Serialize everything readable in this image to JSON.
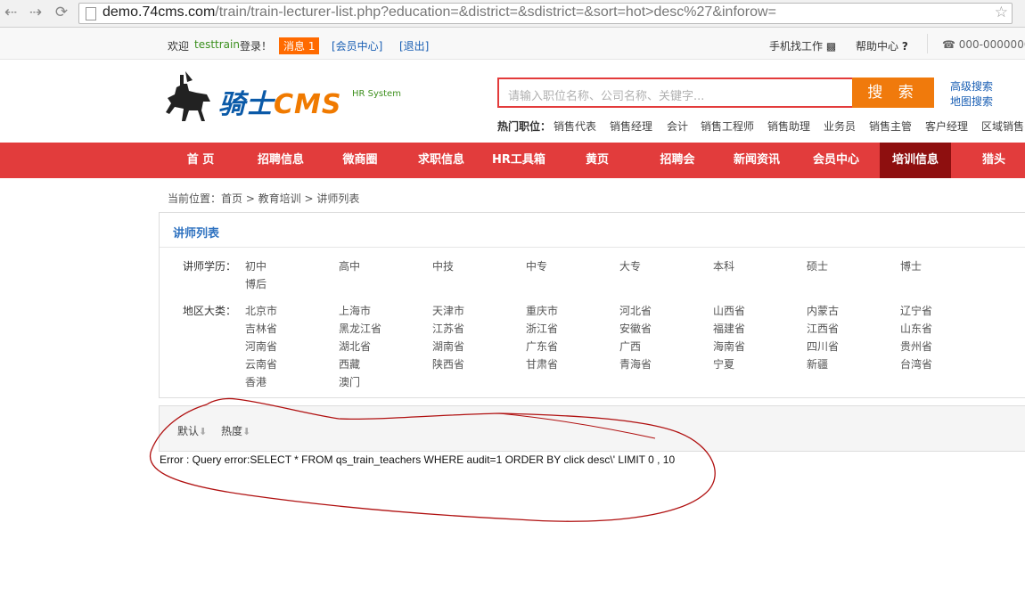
{
  "browser": {
    "url_domain": "demo.74cms.com",
    "url_path": "/train/train-lecturer-list.php?education=&district=&sdistrict=&sort=hot>desc%27&inforow="
  },
  "topbar": {
    "welcome": "欢迎",
    "username": "testtrain",
    "login_suffix": "登录！",
    "message": "消息 1",
    "member_center": "[会员中心]",
    "logout": "[退出]",
    "mobile_job": "手机找工作",
    "help": "帮助中心",
    "phone": "000-0000000"
  },
  "logo": {
    "name": "骑士",
    "cms": "CMS",
    "tagline": "HR System"
  },
  "search": {
    "placeholder": "请输入职位名称、公司名称、关键字...",
    "button": "搜 索",
    "advanced": "高级搜索",
    "map": "地图搜索",
    "hot_label": "热门职位：",
    "hot_items": [
      "销售代表",
      "销售经理",
      "会计",
      "销售工程师",
      "销售助理",
      "业务员",
      "销售主管",
      "客户经理",
      "区域销售"
    ]
  },
  "nav": {
    "items": [
      "首 页",
      "招聘信息",
      "微商圈",
      "求职信息",
      "HR工具箱",
      "黄页",
      "招聘会",
      "新闻资讯",
      "会员中心",
      "培训信息",
      "猎头"
    ],
    "active": "培训信息"
  },
  "breadcrumb": "当前位置：首页 > 教育培训 > 讲师列表",
  "panel": {
    "title": "讲师列表",
    "education_label": "讲师学历：",
    "education": [
      "初中",
      "高中",
      "中技",
      "中专",
      "大专",
      "本科",
      "硕士",
      "博士",
      "博后"
    ],
    "district_label": "地区大类：",
    "districts": [
      "北京市",
      "上海市",
      "天津市",
      "重庆市",
      "河北省",
      "山西省",
      "内蒙古",
      "辽宁省",
      "吉林省",
      "黑龙江省",
      "江苏省",
      "浙江省",
      "安徽省",
      "福建省",
      "江西省",
      "山东省",
      "河南省",
      "湖北省",
      "湖南省",
      "广东省",
      "广西",
      "海南省",
      "四川省",
      "贵州省",
      "云南省",
      "西藏",
      "陕西省",
      "甘肃省",
      "青海省",
      "宁夏",
      "新疆",
      "台湾省",
      "香港",
      "澳门"
    ]
  },
  "sort": {
    "default": "默认",
    "hot": "热度",
    "arrow": "⬇"
  },
  "error_text": "Error : Query error:SELECT * FROM qs_train_teachers WHERE audit=1 ORDER BY click desc\\' LIMIT 0 , 10",
  "colors": {
    "nav_red": "#e23c3c",
    "nav_active": "#8e0f0f",
    "accent_orange": "#f07a0c",
    "link_blue": "#1a5fb4",
    "annotation_red": "#b01010"
  },
  "icons": [
    "back-icon",
    "forward-icon",
    "reload-icon",
    "page-icon",
    "star-icon",
    "mobile-icon",
    "help-icon",
    "phone-icon",
    "sort-arrow-icon"
  ]
}
